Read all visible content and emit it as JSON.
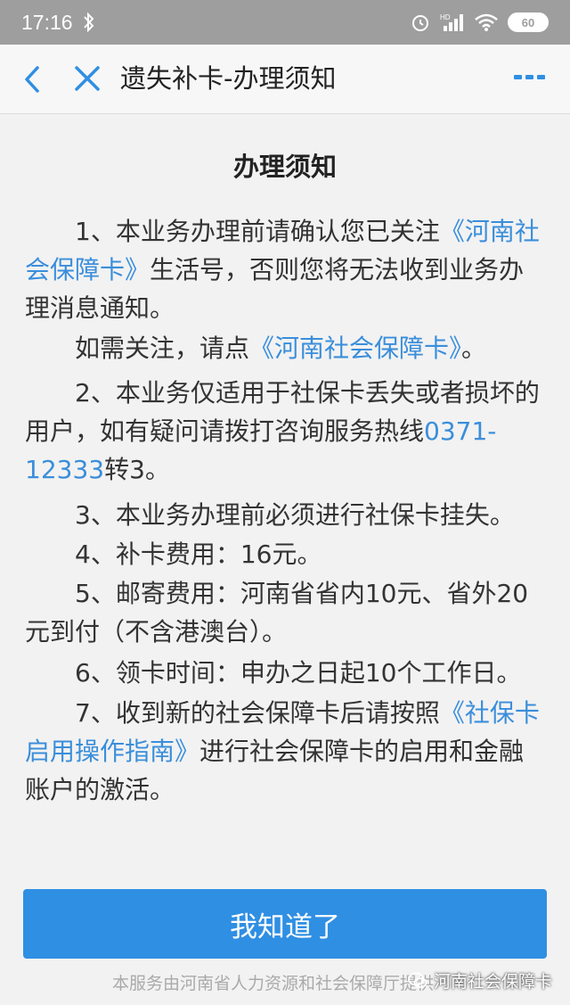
{
  "status_bar": {
    "time": "17:16",
    "battery": "60",
    "network": "HD"
  },
  "nav": {
    "title": "遗失补卡-办理须知"
  },
  "notice": {
    "heading": "办理须知",
    "item1_pre": "1、本业务办理前请确认您已关注",
    "item1_link": "《河南社会保障卡》",
    "item1_post": "生活号，否则您将无法收到业务办理消息通知。",
    "follow_pre": "如需关注，请点",
    "follow_link": "《河南社会保障卡》",
    "follow_post": "。",
    "item2_pre": "2、本业务仅适用于社保卡丢失或者损坏的用户，如有疑问请拨打咨询服务热线",
    "item2_link": "0371-12333",
    "item2_post": "转3。",
    "item3": "3、本业务办理前必须进行社保卡挂失。",
    "item4": "4、补卡费用：16元。",
    "item5": "5、邮寄费用：河南省省内10元、省外20元到付（不含港澳台）。",
    "item6": "6、领卡时间：申办之日起10个工作日。",
    "item7_pre": "7、收到新的社会保障卡后请按照",
    "item7_link": "《社保卡启用操作指南》",
    "item7_post": "进行社会保障卡的启用和金融账户的激活。"
  },
  "button": {
    "ok_label": "我知道了"
  },
  "footer": {
    "text": "本服务由河南省人力资源和社会保障厅提供"
  },
  "watermark": {
    "text": "河南社会保障卡"
  },
  "colors": {
    "accent": "#2f8fe3",
    "link": "#3a8edb",
    "status_bar": "#9e9e9e"
  }
}
